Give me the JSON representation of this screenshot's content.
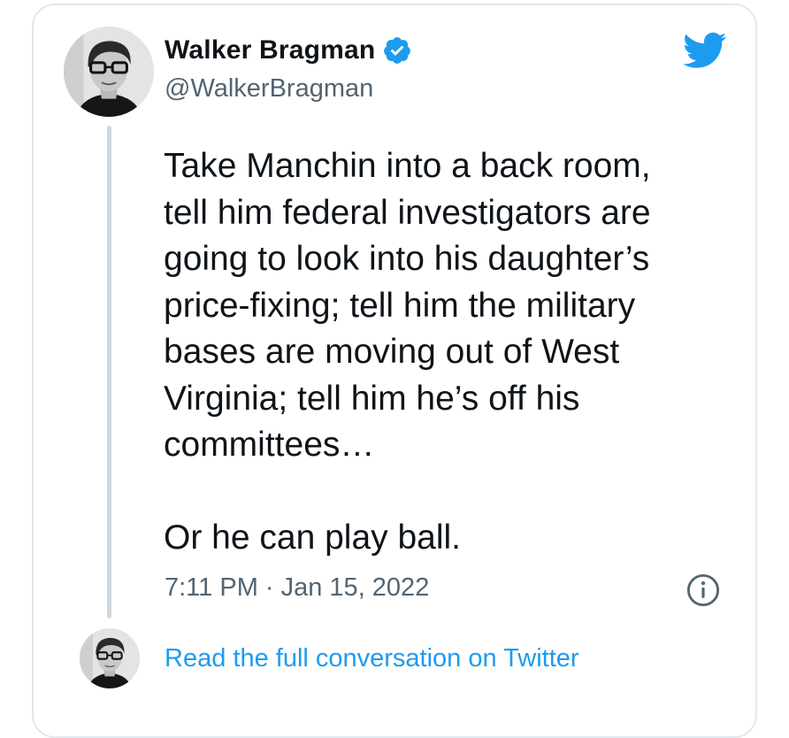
{
  "author": {
    "name": "Walker Bragman",
    "handle": "@WalkerBragman",
    "verified": true
  },
  "tweet": {
    "lines": [
      "Take Manchin into a back room,",
      "tell him federal investigators are",
      "going to look into his daughter’s",
      "price-fixing; tell him the military",
      "bases are moving out of West",
      "Virginia; tell him he’s off his",
      "committees…"
    ],
    "closing": "Or he can play ball.",
    "timestamp": "7:11 PM · Jan 15, 2022"
  },
  "footer": {
    "link_label": "Read the full conversation on Twitter"
  },
  "icons": {
    "logo": "twitter-bird-icon",
    "verified": "verified-badge-icon",
    "info": "info-icon"
  },
  "colors": {
    "brand": "#1d9bf0",
    "text": "#0f1419",
    "secondary": "#536471",
    "border": "#e1e8ed",
    "thread": "#cfd9de"
  }
}
